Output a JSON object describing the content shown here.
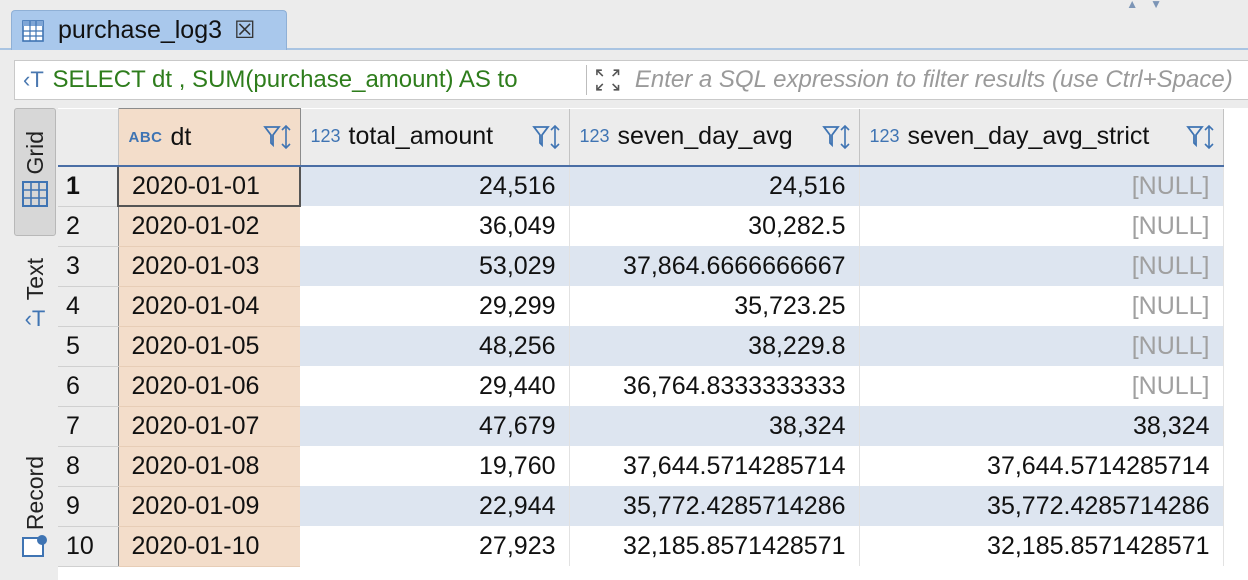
{
  "tab": {
    "title": "purchase_log3",
    "table_icon": "table-grid-icon",
    "close_icon": "close-icon"
  },
  "filter": {
    "query": "SELECT dt , SUM(purchase_amount) AS to",
    "placeholder": "Enter a SQL expression to filter results (use Ctrl+Space)"
  },
  "side_tabs": [
    "Grid",
    "Text",
    "Record"
  ],
  "columns": [
    {
      "type": "ABC",
      "name": "dt"
    },
    {
      "type": "123",
      "name": "total_amount"
    },
    {
      "type": "123",
      "name": "seven_day_avg"
    },
    {
      "type": "123",
      "name": "seven_day_avg_strict"
    }
  ],
  "rows": [
    {
      "n": "1",
      "dt": "2020-01-01",
      "total_amount": "24,516",
      "seven_day_avg": "24,516",
      "seven_day_avg_strict": "[NULL]"
    },
    {
      "n": "2",
      "dt": "2020-01-02",
      "total_amount": "36,049",
      "seven_day_avg": "30,282.5",
      "seven_day_avg_strict": "[NULL]"
    },
    {
      "n": "3",
      "dt": "2020-01-03",
      "total_amount": "53,029",
      "seven_day_avg": "37,864.6666666667",
      "seven_day_avg_strict": "[NULL]"
    },
    {
      "n": "4",
      "dt": "2020-01-04",
      "total_amount": "29,299",
      "seven_day_avg": "35,723.25",
      "seven_day_avg_strict": "[NULL]"
    },
    {
      "n": "5",
      "dt": "2020-01-05",
      "total_amount": "48,256",
      "seven_day_avg": "38,229.8",
      "seven_day_avg_strict": "[NULL]"
    },
    {
      "n": "6",
      "dt": "2020-01-06",
      "total_amount": "29,440",
      "seven_day_avg": "36,764.8333333333",
      "seven_day_avg_strict": "[NULL]"
    },
    {
      "n": "7",
      "dt": "2020-01-07",
      "total_amount": "47,679",
      "seven_day_avg": "38,324",
      "seven_day_avg_strict": "38,324"
    },
    {
      "n": "8",
      "dt": "2020-01-08",
      "total_amount": "19,760",
      "seven_day_avg": "37,644.5714285714",
      "seven_day_avg_strict": "37,644.5714285714"
    },
    {
      "n": "9",
      "dt": "2020-01-09",
      "total_amount": "22,944",
      "seven_day_avg": "35,772.4285714286",
      "seven_day_avg_strict": "35,772.4285714286"
    },
    {
      "n": "10",
      "dt": "2020-01-10",
      "total_amount": "27,923",
      "seven_day_avg": "32,185.8571428571",
      "seven_day_avg_strict": "32,185.8571428571"
    }
  ],
  "colors": {
    "accent": "#4a6ea5",
    "tab_bg": "#a9c8ec",
    "dt_bg": "#f3ddca",
    "row_stripe": "#dde5f0",
    "query_text": "#2e7d1c",
    "null_text": "#a0a0a0"
  }
}
